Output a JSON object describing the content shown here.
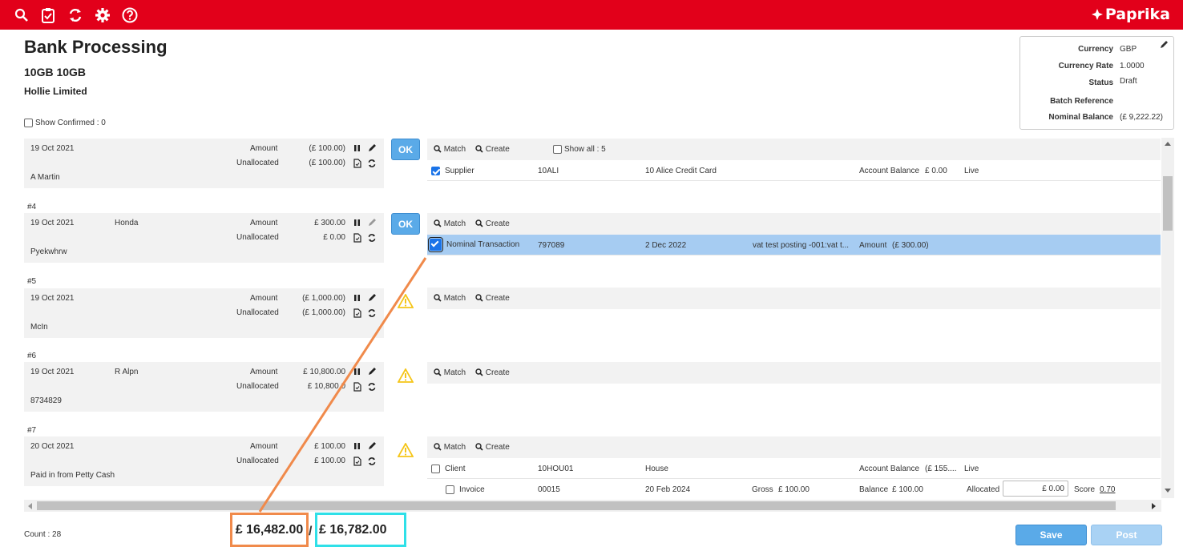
{
  "brand": "Paprika",
  "page": {
    "title": "Bank Processing",
    "subtitle": "10GB 10GB",
    "company": "Hollie Limited",
    "show_confirmed": "Show Confirmed : 0"
  },
  "info": [
    {
      "label": "Currency",
      "value": "GBP"
    },
    {
      "label": "Currency Rate",
      "value": "1.0000"
    },
    {
      "label": "Status",
      "value": "Draft"
    },
    {
      "label": "Batch Reference",
      "value": ""
    },
    {
      "label": "Nominal Balance",
      "value": "(£ 9,222.22)"
    }
  ],
  "common": {
    "amount": "Amount",
    "unallocated": "Unallocated",
    "ok": "OK",
    "match": "Match",
    "create": "Create"
  },
  "transactions": [
    {
      "num": "",
      "date": "19 Oct 2021",
      "ref": "",
      "amount": "(£ 100.00)",
      "unallocated": "(£ 100.00)",
      "payee": "A Martin",
      "show_all": "Show all : 5"
    },
    {
      "num": "#4",
      "date": "19 Oct 2021",
      "ref": "Honda",
      "amount": "£ 300.00",
      "unallocated": "£ 0.00",
      "payee": "Pyekwhrw"
    },
    {
      "num": "#5",
      "date": "19 Oct 2021",
      "ref": "",
      "amount": "(£ 1,000.00)",
      "unallocated": "(£ 1,000.00)",
      "payee": "McIn"
    },
    {
      "num": "#6",
      "date": "19 Oct 2021",
      "ref": "R Alpn",
      "amount": "£ 10,800.00",
      "unallocated": "£ 10,800.0",
      "payee": "8734829"
    },
    {
      "num": "#7",
      "date": "20 Oct 2021",
      "ref": "",
      "amount": "£ 100.00",
      "unallocated": "£ 100.00",
      "payee": "Paid in from Petty Cash"
    }
  ],
  "matches": {
    "m1": {
      "type": "Supplier",
      "code": "10ALI",
      "name": "10 Alice Credit Card",
      "bal_label": "Account Balance",
      "bal": "£ 0.00",
      "state": "Live"
    },
    "m2": {
      "type": "Nominal Transaction",
      "code": "797089",
      "date": "2 Dec 2022",
      "desc": "vat test posting -001:vat t...",
      "amt_label": "Amount",
      "amt": "(£ 300.00)"
    },
    "m3": {
      "type": "Client",
      "code": "10HOU01",
      "name": "House",
      "bal_label": "Account Balance",
      "bal": "(£ 155....",
      "state": "Live"
    },
    "m4": {
      "type": "Invoice",
      "code": "00015",
      "date": "20 Feb 2024",
      "gross_label": "Gross",
      "gross": "£ 100.00",
      "bal_label": "Balance",
      "bal": "£ 100.00",
      "alloc_label": "Allocated",
      "alloc": "£ 0.00",
      "score_label": "Score",
      "score": "0.70"
    }
  },
  "footer": {
    "count": "Count : 28",
    "total1": "£ 16,482.00",
    "slash": "/",
    "total2": "£ 16,782.00",
    "save": "Save",
    "post": "Post"
  },
  "colors": {
    "topbar": "#e2001a",
    "highlight": "#a6ccf2",
    "ok": "#5aaae8",
    "annot_orange": "#f08a4b",
    "annot_cyan": "#2fe0e8"
  }
}
